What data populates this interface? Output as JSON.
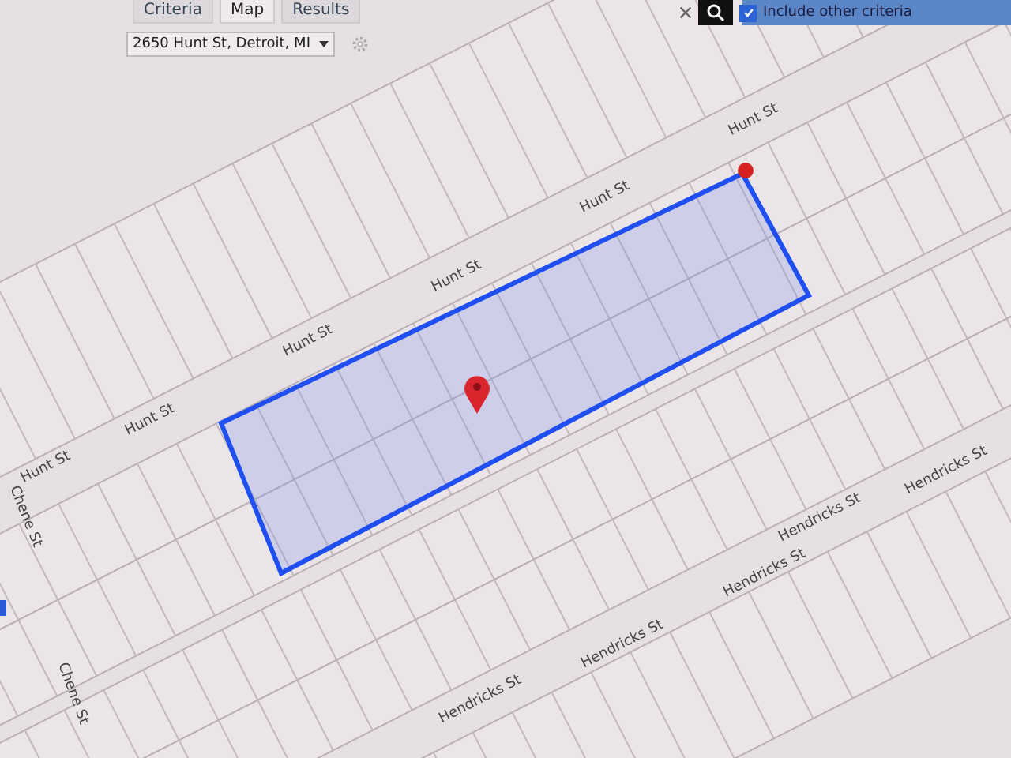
{
  "tabs": [
    {
      "label": "Criteria",
      "selected": false
    },
    {
      "label": "Map",
      "selected": true
    },
    {
      "label": "Results",
      "selected": false
    }
  ],
  "location_select": {
    "value": "2650 Hunt St, Detroit, MI"
  },
  "include_other_criteria": {
    "label": "Include other criteria",
    "checked": true
  },
  "map": {
    "street_labels": [
      {
        "text": "Hunt St"
      },
      {
        "text": "Hunt St"
      },
      {
        "text": "Hunt St"
      },
      {
        "text": "Hunt St"
      },
      {
        "text": "Hunt St"
      },
      {
        "text": "Hunt St"
      },
      {
        "text": "Chene St"
      },
      {
        "text": "Chene St"
      },
      {
        "text": "Hendricks St"
      },
      {
        "text": "Hendricks St"
      },
      {
        "text": "Hendricks St"
      },
      {
        "text": "Hendricks St"
      },
      {
        "text": "Hendricks St"
      }
    ]
  }
}
